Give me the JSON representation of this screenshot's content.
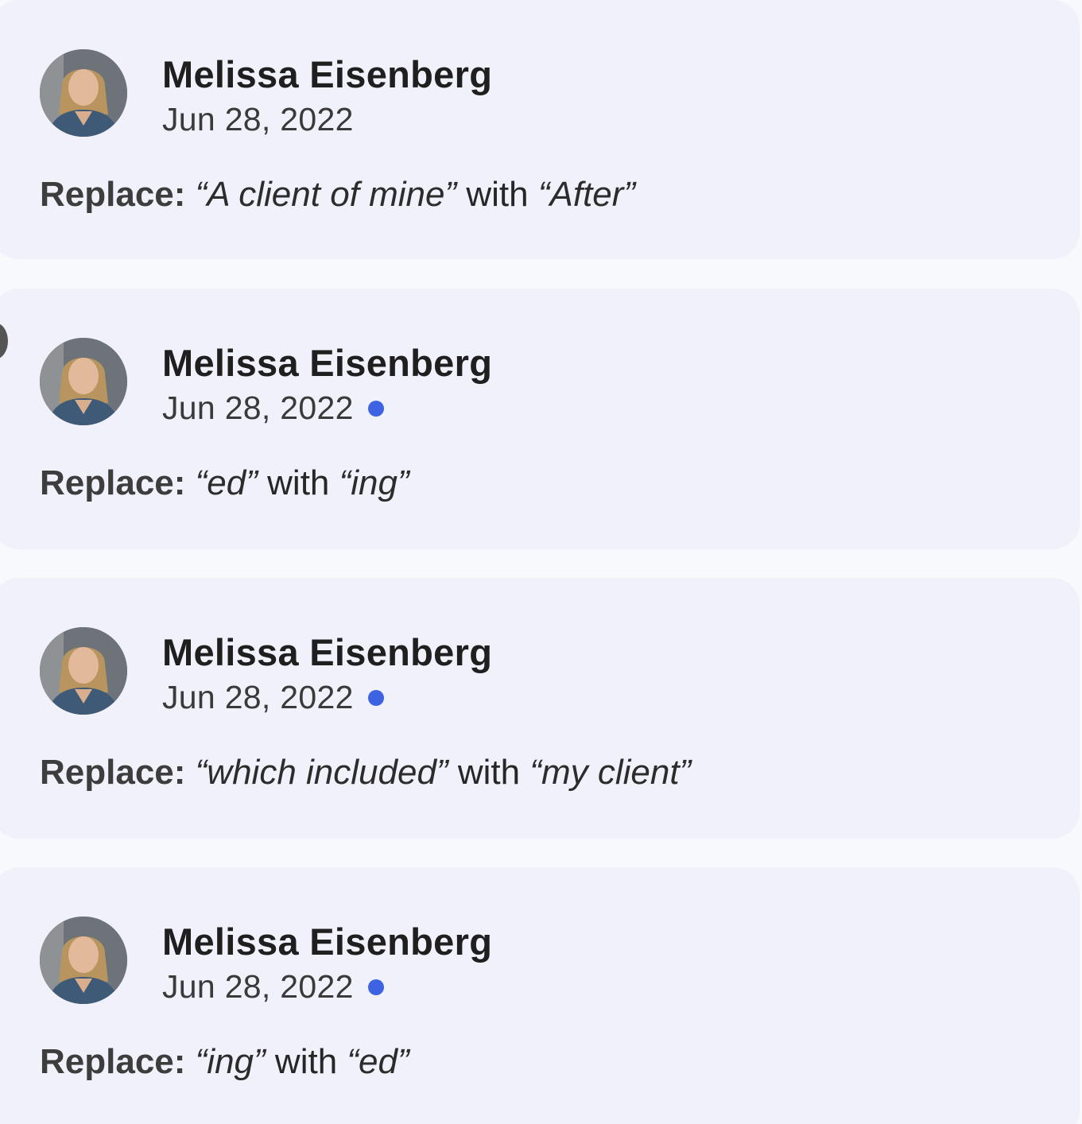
{
  "suggestions": [
    {
      "author": "Melissa Eisenberg",
      "date": "Jun 28, 2022",
      "unread": false,
      "action_label": "Replace:",
      "from_text": "“A client of mine”",
      "connector": "with",
      "to_text": "“After”"
    },
    {
      "author": "Melissa Eisenberg",
      "date": "Jun 28, 2022",
      "unread": true,
      "action_label": "Replace:",
      "from_text": "“ed”",
      "connector": "with",
      "to_text": "“ing”"
    },
    {
      "author": "Melissa Eisenberg",
      "date": "Jun 28, 2022",
      "unread": true,
      "action_label": "Replace:",
      "from_text": "“which included”",
      "connector": "with",
      "to_text": "“my client”"
    },
    {
      "author": "Melissa Eisenberg",
      "date": "Jun 28, 2022",
      "unread": true,
      "action_label": "Replace:",
      "from_text": "“ing”",
      "connector": "with",
      "to_text": "“ed”"
    }
  ],
  "colors": {
    "unread_dot": "#3d63e2",
    "card_background": "#f0f1fb",
    "page_background": "#f8f9fd"
  }
}
